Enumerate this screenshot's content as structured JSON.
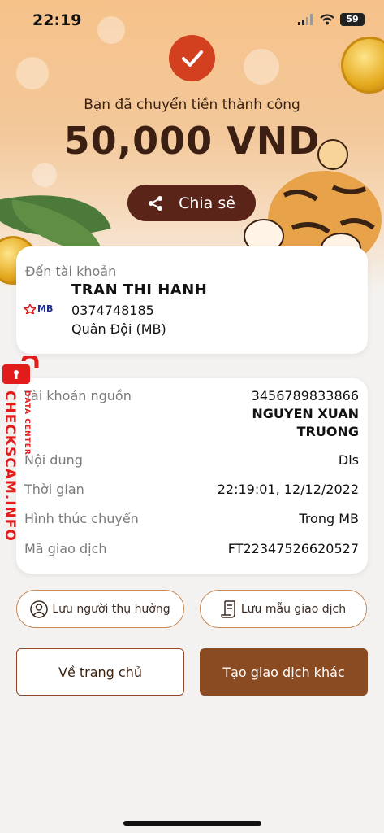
{
  "status_bar": {
    "time": "22:19",
    "battery": "59"
  },
  "header": {
    "success_message": "Bạn đã chuyển tiền thành công",
    "amount": "50,000 VND",
    "share_label": "Chia sẻ"
  },
  "recipient": {
    "label": "Đến tài khoản",
    "bank_logo": "MB",
    "name": "TRAN THI HANH",
    "account_number": "0374748185",
    "bank_name": "Quân Đội (MB)"
  },
  "details": {
    "source_account_label": "Tài khoản nguồn",
    "source_account_number": "3456789833866",
    "source_account_name": "NGUYEN XUAN TRUONG",
    "content_label": "Nội dung",
    "content_value": "Dls",
    "time_label": "Thời gian",
    "time_value": "22:19:01, 12/12/2022",
    "method_label": "Hình thức chuyển",
    "method_value": "Trong MB",
    "transaction_id_label": "Mã giao dịch",
    "transaction_id_value": "FT22347526620527"
  },
  "actions": {
    "save_beneficiary": "Lưu người thụ hưởng",
    "save_template": "Lưu mẫu giao dịch",
    "go_home": "Về trang chủ",
    "new_transaction": "Tạo giao dịch khác"
  },
  "watermark": {
    "main": "CHECKSCAM.INFO",
    "sub": "DATA CENTER"
  },
  "colors": {
    "accent_red": "#d2401f",
    "brown_dark": "#5a2418",
    "brown_button": "#8a4a22",
    "watermark_red": "#e21b1b"
  },
  "icons": [
    "check-icon",
    "share-icon",
    "user-icon",
    "document-icon",
    "wifi-icon",
    "signal-icon",
    "battery-icon"
  ]
}
